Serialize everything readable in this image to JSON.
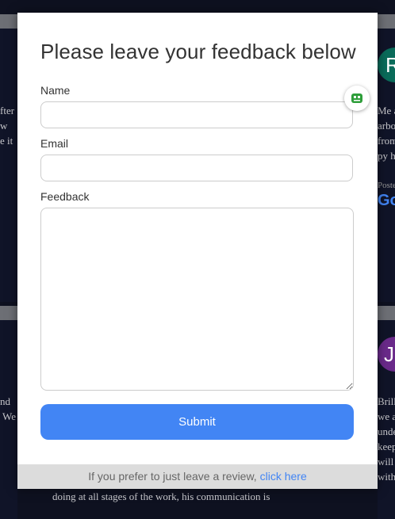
{
  "modal": {
    "title": "Please leave your feedback below",
    "fields": {
      "name_label": "Name",
      "email_label": "Email",
      "feedback_label": "Feedback"
    },
    "submit_label": "Submit",
    "footer": {
      "text": "If you prefer to just leave a review,",
      "link": "click here"
    }
  },
  "background": {
    "left_top_text": "fter\nw\ne it",
    "left_bottom_text": "nd\n We",
    "right_top_avatar": "R",
    "right_top_text": "Me a\narbo\nfrom\npy h",
    "right_top_posted": "Poste",
    "right_top_google": "Go",
    "right_bottom_avatar": "J",
    "right_bottom_text": "Brill\nwe a\nunde\nkeep\nwill\nwith",
    "bottom_center_text": "doing at all stages of the work, his communication is"
  },
  "colors": {
    "accent": "#4285f4",
    "widget_icon": "#2e9e3a"
  }
}
